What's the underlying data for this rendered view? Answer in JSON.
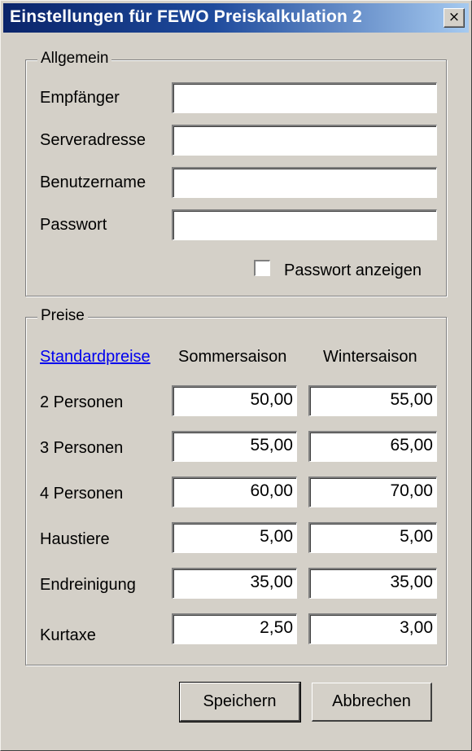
{
  "window": {
    "title": "Einstellungen für FEWO Preiskalkulation 2",
    "close_symbol": "×"
  },
  "allgemein": {
    "legend": "Allgemein",
    "fields": [
      {
        "label": "Empfänger",
        "value": ""
      },
      {
        "label": "Serveradresse",
        "value": ""
      },
      {
        "label": "Benutzername",
        "value": ""
      },
      {
        "label": "Passwort",
        "value": ""
      }
    ],
    "show_password": {
      "label": "Passwort anzeigen",
      "checked": false
    }
  },
  "preise": {
    "legend": "Preise",
    "standard_link": "Standardpreise",
    "col_summer": "Sommersaison",
    "col_winter": "Wintersaison",
    "rows": [
      {
        "label": "2 Personen",
        "summer": "50,00",
        "winter": "55,00"
      },
      {
        "label": "3 Personen",
        "summer": "55,00",
        "winter": "65,00"
      },
      {
        "label": "4 Personen",
        "summer": "60,00",
        "winter": "70,00"
      },
      {
        "label": "Haustiere",
        "summer": "5,00",
        "winter": "5,00"
      },
      {
        "label": "Endreinigung",
        "summer": "35,00",
        "winter": "35,00"
      },
      {
        "label": "Kurtaxe",
        "summer": "2,50",
        "winter": "3,00"
      }
    ]
  },
  "buttons": {
    "save": "Speichern",
    "cancel": "Abbrechen"
  }
}
